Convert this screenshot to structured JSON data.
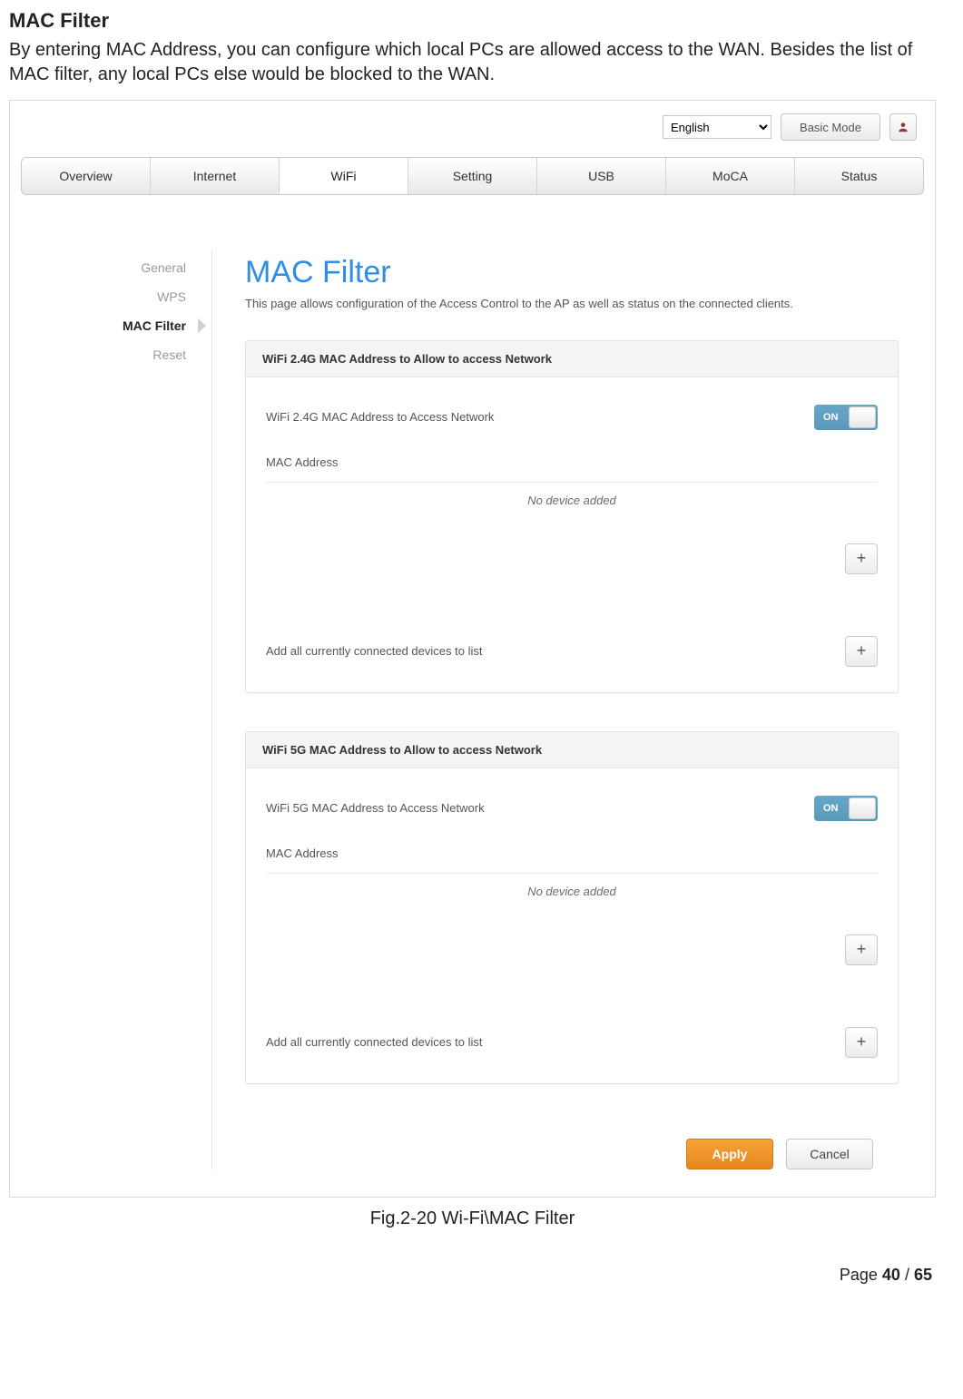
{
  "doc": {
    "heading": "MAC Filter",
    "paragraph": "By entering MAC Address, you can configure which local PCs are allowed access to the WAN. Besides the list of MAC filter, any local PCs else would be blocked to the WAN.",
    "caption": "Fig.2-20 Wi-Fi\\MAC Filter",
    "page_prefix": "Page ",
    "page_current": "40",
    "page_sep": " / ",
    "page_total": "65"
  },
  "top": {
    "language": "English",
    "basic_mode": "Basic Mode"
  },
  "tabs": {
    "overview": "Overview",
    "internet": "Internet",
    "wifi": "WiFi",
    "setting": "Setting",
    "usb": "USB",
    "moca": "MoCA",
    "status": "Status"
  },
  "sidebar": {
    "general": "General",
    "wps": "WPS",
    "mac_filter": "MAC Filter",
    "reset": "Reset"
  },
  "content": {
    "title": "MAC Filter",
    "desc": "This page allows configuration of the Access Control to the AP as well as status on the connected clients."
  },
  "panel24": {
    "header": "WiFi 2.4G MAC Address to Allow to access Network",
    "access_label": "WiFi 2.4G MAC Address to Access Network",
    "toggle": "ON",
    "mac_label": "MAC Address",
    "no_device": "No device added",
    "add_all": "Add all currently connected devices to list"
  },
  "panel5": {
    "header": "WiFi 5G MAC Address to Allow to access Network",
    "access_label": "WiFi 5G MAC Address to Access Network",
    "toggle": "ON",
    "mac_label": "MAC Address",
    "no_device": "No device added",
    "add_all": "Add all currently connected devices to list"
  },
  "actions": {
    "apply": "Apply",
    "cancel": "Cancel"
  }
}
